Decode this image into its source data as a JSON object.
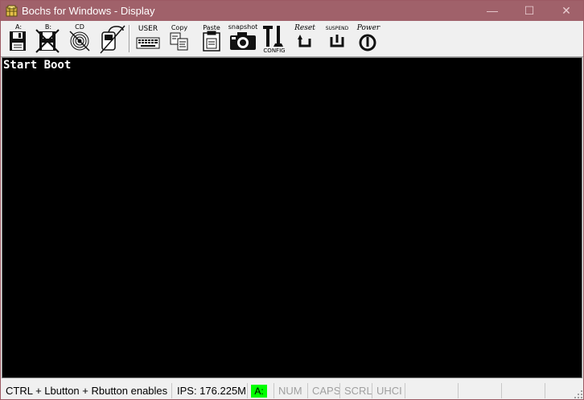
{
  "window": {
    "title": "Bochs for Windows - Display",
    "minimize_icon": "—",
    "maximize_icon": "☐",
    "close_icon": "✕"
  },
  "toolbar": {
    "floppy_a_label": "A:",
    "floppy_b_label": "B:",
    "cdrom_label": "CD",
    "user_label": "USER",
    "copy_label": "Copy",
    "paste_label": "Paste",
    "snapshot_label": "snapshot",
    "config_label": "CONFIG",
    "reset_label": "Reset",
    "suspend_label": "SUSPEND",
    "power_label": "Power"
  },
  "screen": {
    "console_text": "Start Boot"
  },
  "statusbar": {
    "mouse_hint": "CTRL + Lbutton + Rbutton enables",
    "ips": "IPS: 176.225M",
    "drive_a": "A:",
    "num": "NUM",
    "caps": "CAPS",
    "scrl": "SCRL",
    "uhci": "UHCI"
  },
  "colors": {
    "titlebar": "#a0616a",
    "screen_bg": "#000000",
    "drive_a_active": "#00ff00",
    "inactive_text": "#a0a0a0"
  }
}
